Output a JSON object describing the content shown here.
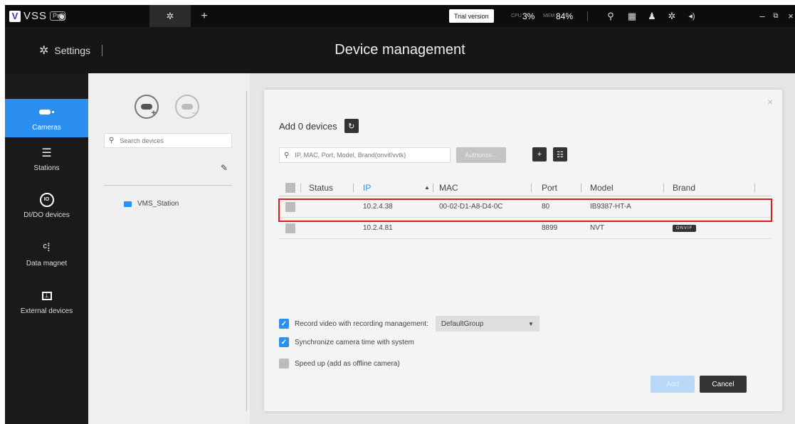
{
  "app": {
    "logo_text": "VSS",
    "logo_badge": "Pro",
    "trial_label": "Trial version",
    "cpu_label": "CPU",
    "cpu_value": "3%",
    "mem_label": "MEM",
    "mem_value": "84%",
    "window_min": "–",
    "window_restore": "⧉",
    "window_close": "×"
  },
  "header": {
    "section_label": "Settings",
    "page_title": "Device management"
  },
  "nav": {
    "items": [
      {
        "label": "Cameras",
        "icon": "camera-icon"
      },
      {
        "label": "Stations",
        "icon": "server-icon"
      },
      {
        "label": "DI/DO devices",
        "icon": "io-icon"
      },
      {
        "label": "Data magnet",
        "icon": "data-magnet-icon"
      },
      {
        "label": "External devices",
        "icon": "external-device-icon"
      }
    ]
  },
  "tree": {
    "search_placeholder": "Search devices",
    "station_name": "VMS_Station"
  },
  "dialog": {
    "title": "Add 0 devices",
    "filter_placeholder": "IP, MAC, Port, Model, Brand(onvif/vvtk)",
    "authorize_label": "Authorize...",
    "columns": {
      "status": "Status",
      "ip": "IP",
      "mac": "MAC",
      "port": "Port",
      "model": "Model",
      "brand": "Brand"
    },
    "rows": [
      {
        "status": "",
        "ip": "10.2.4.38",
        "mac": "00-02-D1-A8-D4-0C",
        "port": "80",
        "model": "IB9387-HT-A",
        "brand": ""
      },
      {
        "status": "",
        "ip": "10.2.4.81",
        "mac": "",
        "port": "8899",
        "model": "NVT",
        "brand": "ONVIF"
      }
    ],
    "options": {
      "record_label": "Record video with recording management:",
      "record_group": "DefaultGroup",
      "sync_label": "Synchronize camera time with system",
      "speedup_label": "Speed up (add as offline camera)"
    },
    "add_label": "Add",
    "cancel_label": "Cancel"
  },
  "colors": {
    "accent": "#2a8ff0",
    "highlight": "#e0191b",
    "topbar": "#0d0d0d",
    "sidebar": "#1a1a1a"
  }
}
